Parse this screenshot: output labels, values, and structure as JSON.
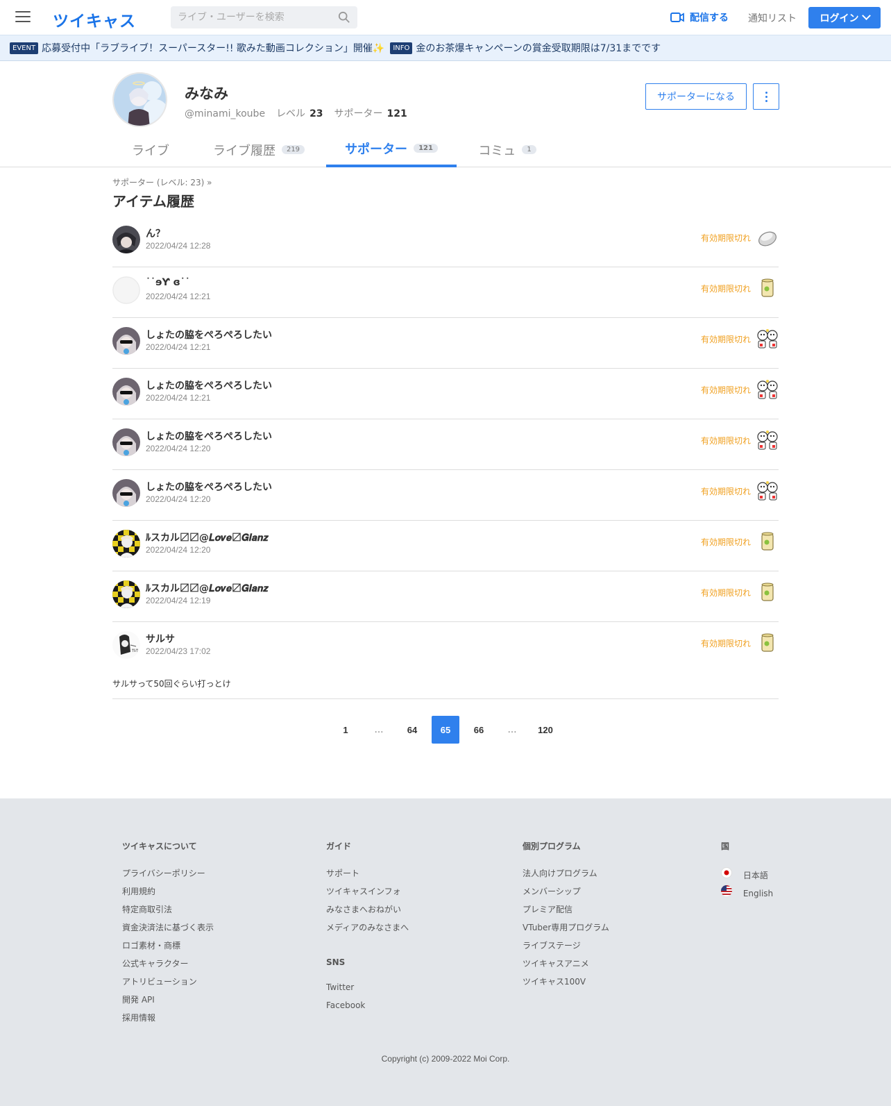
{
  "header": {
    "logo": "ツイキャス",
    "search_placeholder": "ライブ・ユーザーを検索",
    "broadcast_label": "配信する",
    "notify_label": "通知リスト",
    "login_label": "ログイン"
  },
  "announcements": [
    {
      "tag": "EVENT",
      "text": "応募受付中「ラブライブ！スーパースター!! 歌みた動画コレクション」開催✨"
    },
    {
      "tag": "INFO",
      "text": "金のお茶爆キャンペーンの賞金受取期限は7/31までです"
    }
  ],
  "profile": {
    "name": "みなみ",
    "handle": "@minami_koube",
    "level_label": "レベル",
    "level": "23",
    "supporter_label": "サポーター",
    "supporters": "121",
    "support_button": "サポーターになる"
  },
  "tabs": [
    {
      "label": "ライブ",
      "count": ""
    },
    {
      "label": "ライブ履歴",
      "count": "219"
    },
    {
      "label": "サポーター",
      "count": "121"
    },
    {
      "label": "コミュ",
      "count": "1"
    }
  ],
  "breadcrumb": "サポーター (レベル: 23)  »",
  "page_title": "アイテム履歴",
  "items": [
    {
      "name": "ん？",
      "date": "2022/04/24 12:28",
      "status": "有効期限切れ",
      "item_icon": "rice-ball-item-icon"
    },
    {
      "name": "˙˙ɘƳ ɞ˙˙",
      "date": "2022/04/24 12:21",
      "status": "有効期限切れ",
      "item_icon": "tea-cup-item-icon"
    },
    {
      "name": "しょたの脇をぺろぺろしたい",
      "date": "2022/04/24 12:21",
      "status": "有効期限切れ",
      "item_icon": "characters-item-icon"
    },
    {
      "name": "しょたの脇をぺろぺろしたい",
      "date": "2022/04/24 12:21",
      "status": "有効期限切れ",
      "item_icon": "characters-item-icon"
    },
    {
      "name": "しょたの脇をぺろぺろしたい",
      "date": "2022/04/24 12:20",
      "status": "有効期限切れ",
      "item_icon": "characters-item-icon"
    },
    {
      "name": "しょたの脇をぺろぺろしたい",
      "date": "2022/04/24 12:20",
      "status": "有効期限切れ",
      "item_icon": "characters-item-icon"
    },
    {
      "name": "ﾙスカル〼〼@𝑳𝒐𝒗𝒆〼𝑮𝒍𝒂𝒏𝒛",
      "date": "2022/04/24 12:20",
      "status": "有効期限切れ",
      "item_icon": "tea-cup-item-icon"
    },
    {
      "name": "ﾙスカル〼〼@𝑳𝒐𝒗𝒆〼𝑮𝒍𝒂𝒏𝒛",
      "date": "2022/04/24 12:19",
      "status": "有効期限切れ",
      "item_icon": "tea-cup-item-icon"
    },
    {
      "name": "サルサ",
      "date": "2022/04/23 17:02",
      "status": "有効期限切れ",
      "item_icon": "tea-cup-item-icon",
      "comment": "サルサって50回ぐらい打っとけ"
    }
  ],
  "pagination": {
    "pages": [
      "1",
      "…",
      "64",
      "65",
      "66",
      "…",
      "120"
    ],
    "current": "65"
  },
  "footer": {
    "about": {
      "title": "ツイキャスについて",
      "links": [
        "プライバシーポリシー",
        "利用規約",
        "特定商取引法",
        "資金決済法に基づく表示",
        "ロゴ素材・商標",
        "公式キャラクター",
        "アトリビューション",
        "開発 API",
        "採用情報"
      ]
    },
    "guide": {
      "title": "ガイド",
      "links": [
        "サポート",
        "ツイキャスインフォ",
        "みなさまへおねがい",
        "メディアのみなさまへ"
      ]
    },
    "sns": {
      "title": "SNS",
      "links": [
        "Twitter",
        "Facebook"
      ]
    },
    "programs": {
      "title": "個別プログラム",
      "links": [
        "法人向けプログラム",
        "メンバーシップ",
        "プレミア配信",
        "VTuber専用プログラム",
        "ライブステージ",
        "ツイキャスアニメ",
        "ツイキャス100V"
      ]
    },
    "country": {
      "title": "国",
      "langs": [
        "日本語",
        "English"
      ]
    },
    "copyright": "Copyright (c) 2009-2022 Moi Corp."
  },
  "colors": {
    "accent": "#2f80ed",
    "expired": "#f0a020",
    "announce_bg": "#e8f1fc",
    "footer_bg": "#e3e6ea"
  }
}
